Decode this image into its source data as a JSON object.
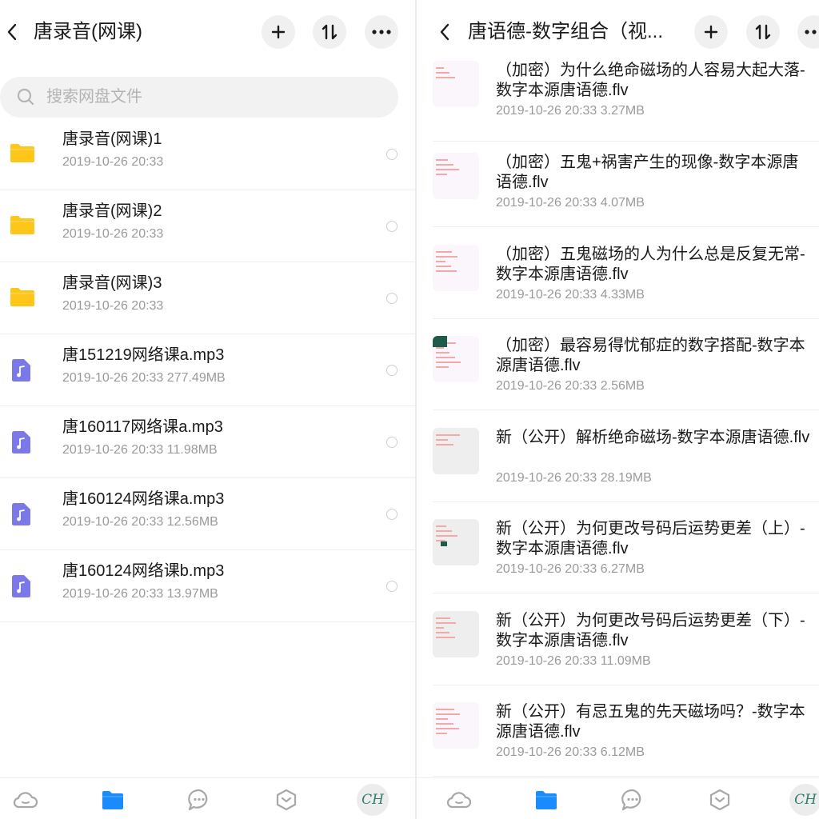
{
  "left": {
    "title": "唐录音(网课)",
    "search_placeholder": "搜索网盘文件",
    "items": [
      {
        "type": "folder",
        "name": "唐录音(网课)1",
        "meta": "2019-10-26  20:33"
      },
      {
        "type": "folder",
        "name": "唐录音(网课)2",
        "meta": "2019-10-26  20:33"
      },
      {
        "type": "folder",
        "name": "唐录音(网课)3",
        "meta": "2019-10-26  20:33"
      },
      {
        "type": "audio",
        "name": "唐151219网络课a.mp3",
        "meta": "2019-10-26  20:33   277.49MB"
      },
      {
        "type": "audio",
        "name": "唐160117网络课a.mp3",
        "meta": "2019-10-26  20:33   11.98MB"
      },
      {
        "type": "audio",
        "name": "唐160124网络课a.mp3",
        "meta": "2019-10-26  20:33   12.56MB"
      },
      {
        "type": "audio",
        "name": "唐160124网络课b.mp3",
        "meta": "2019-10-26  20:33   13.97MB"
      }
    ],
    "avatar_text": "CH"
  },
  "right": {
    "title": "唐语德-数字组合（视...",
    "items": [
      {
        "name": "（加密）为什么绝命磁场的人容易大起大落-数字本源唐语德.flv",
        "meta": "2019-10-26  20:33   3.27MB"
      },
      {
        "name": "（加密）五鬼+祸害产生的现像-数字本源唐语德.flv",
        "meta": "2019-10-26  20:33   4.07MB"
      },
      {
        "name": "（加密）五鬼磁场的人为什么总是反复无常-数字本源唐语德.flv",
        "meta": "2019-10-26  20:33   4.33MB"
      },
      {
        "name": "（加密）最容易得忧郁症的数字搭配-数字本源唐语德.flv",
        "meta": "2019-10-26  20:33   2.56MB"
      },
      {
        "name": "新（公开）解析绝命磁场-数字本源唐语德.flv",
        "meta": "2019-10-26  20:33   28.19MB"
      },
      {
        "name": "新（公开）为何更改号码后运势更差（上）-数字本源唐语德.flv",
        "meta": "2019-10-26  20:33   6.27MB"
      },
      {
        "name": "新（公开）为何更改号码后运势更差（下）-数字本源唐语德.flv",
        "meta": "2019-10-26  20:33   11.09MB"
      },
      {
        "name": "新（公开）有忌五鬼的先天磁场吗？-数字本源唐语德.flv",
        "meta": "2019-10-26  20:33   6.12MB"
      }
    ],
    "avatar_text": "CH"
  },
  "colors": {
    "folder": "#ffc61a",
    "audio": "#7b78e8",
    "active_tab": "#1a8cff",
    "inactive_tab": "#a8a8a8"
  },
  "icons": {
    "back": "chevron-left-icon",
    "add": "plus-icon",
    "sort": "sort-icon",
    "more": "more-icon",
    "search": "search-icon",
    "nav": [
      "cloud-icon",
      "files-icon",
      "chat-icon",
      "box-icon"
    ]
  }
}
